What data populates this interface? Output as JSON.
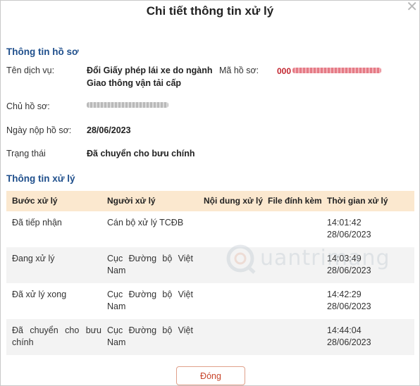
{
  "modal": {
    "title": "Chi tiết thông tin xử lý",
    "close_icon": "close-icon"
  },
  "profile": {
    "section_title": "Thông tin hồ sơ",
    "service_label": "Tên dịch vụ:",
    "service_value_line1": "Đổi Giấy phép lái xe do ngành",
    "service_value_line2": "Giao thông vận tải cấp",
    "code_label": "Mã hồ sơ:",
    "code_prefix": "000",
    "owner_label": "Chủ hồ sơ:",
    "submit_date_label": "Ngày nộp hồ sơ:",
    "submit_date_value": "28/06/2023",
    "status_label": "Trạng thái",
    "status_value": "Đã chuyển cho bưu chính"
  },
  "processing": {
    "section_title": "Thông tin xử lý",
    "columns": [
      "Bước xử lý",
      "Người xử lý",
      "Nội dung xử lý",
      "File đính kèm",
      "Thời gian xử lý"
    ],
    "rows": [
      {
        "step_1": "Đã tiếp nhận",
        "step_2": "",
        "handler_1": "Cán bộ xử lý TCĐB",
        "handler_2": "",
        "content": "",
        "file": "",
        "time": "14:01:42",
        "date": "28/06/2023"
      },
      {
        "step_1": "Đang xử lý",
        "step_2": "",
        "handler_1": "Cục Đường bộ Việt",
        "handler_2": "Nam",
        "content": "",
        "file": "",
        "time": "14:03:49",
        "date": "28/06/2023"
      },
      {
        "step_1": "Đã xử lý xong",
        "step_2": "",
        "handler_1": "Cục Đường bộ Việt",
        "handler_2": "Nam",
        "content": "",
        "file": "",
        "time": "14:42:29",
        "date": "28/06/2023"
      },
      {
        "step_1": "Đã chuyển cho bưu",
        "step_2": "chính",
        "handler_1": "Cục Đường bộ Việt",
        "handler_2": "Nam",
        "content": "",
        "file": "",
        "time": "14:44:04",
        "date": "28/06/2023"
      }
    ]
  },
  "footer": {
    "close_button": "Đóng"
  },
  "watermark": {
    "text": "uantrimang"
  },
  "colors": {
    "section_title": "#1f4f8c",
    "table_header_bg": "#fbe8cf",
    "button_text": "#c8452b",
    "code_red": "#c2252f"
  }
}
